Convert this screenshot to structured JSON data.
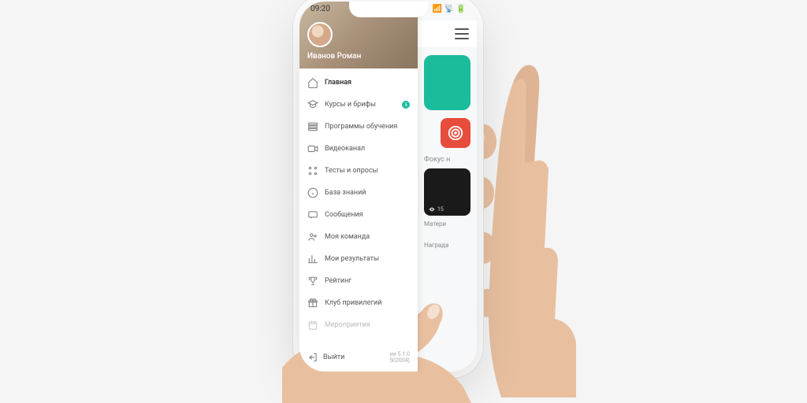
{
  "statusbar": {
    "time": "09:20",
    "signal": "●●●",
    "wifi_battery": "⚡■"
  },
  "user": {
    "name": "Иванов Роман"
  },
  "menu": {
    "items": [
      {
        "label": "Главная",
        "active": true
      },
      {
        "label": "Курсы и брифы",
        "badge": "5"
      },
      {
        "label": "Программы обучения"
      },
      {
        "label": "Видеоканал"
      },
      {
        "label": "Тесты и опросы"
      },
      {
        "label": "База знаний"
      },
      {
        "label": "Сообщения"
      },
      {
        "label": "Моя команда"
      },
      {
        "label": "Мои результаты"
      },
      {
        "label": "Рейтинг"
      },
      {
        "label": "Клуб привилегий"
      },
      {
        "label": "Мероприятия"
      }
    ],
    "exit": "Выйти",
    "version": "ия 5.1.0",
    "build": "502004)"
  },
  "main": {
    "section1": "Фокус н",
    "views": "15",
    "material_label": "Матери",
    "awards_label": "Награда"
  }
}
